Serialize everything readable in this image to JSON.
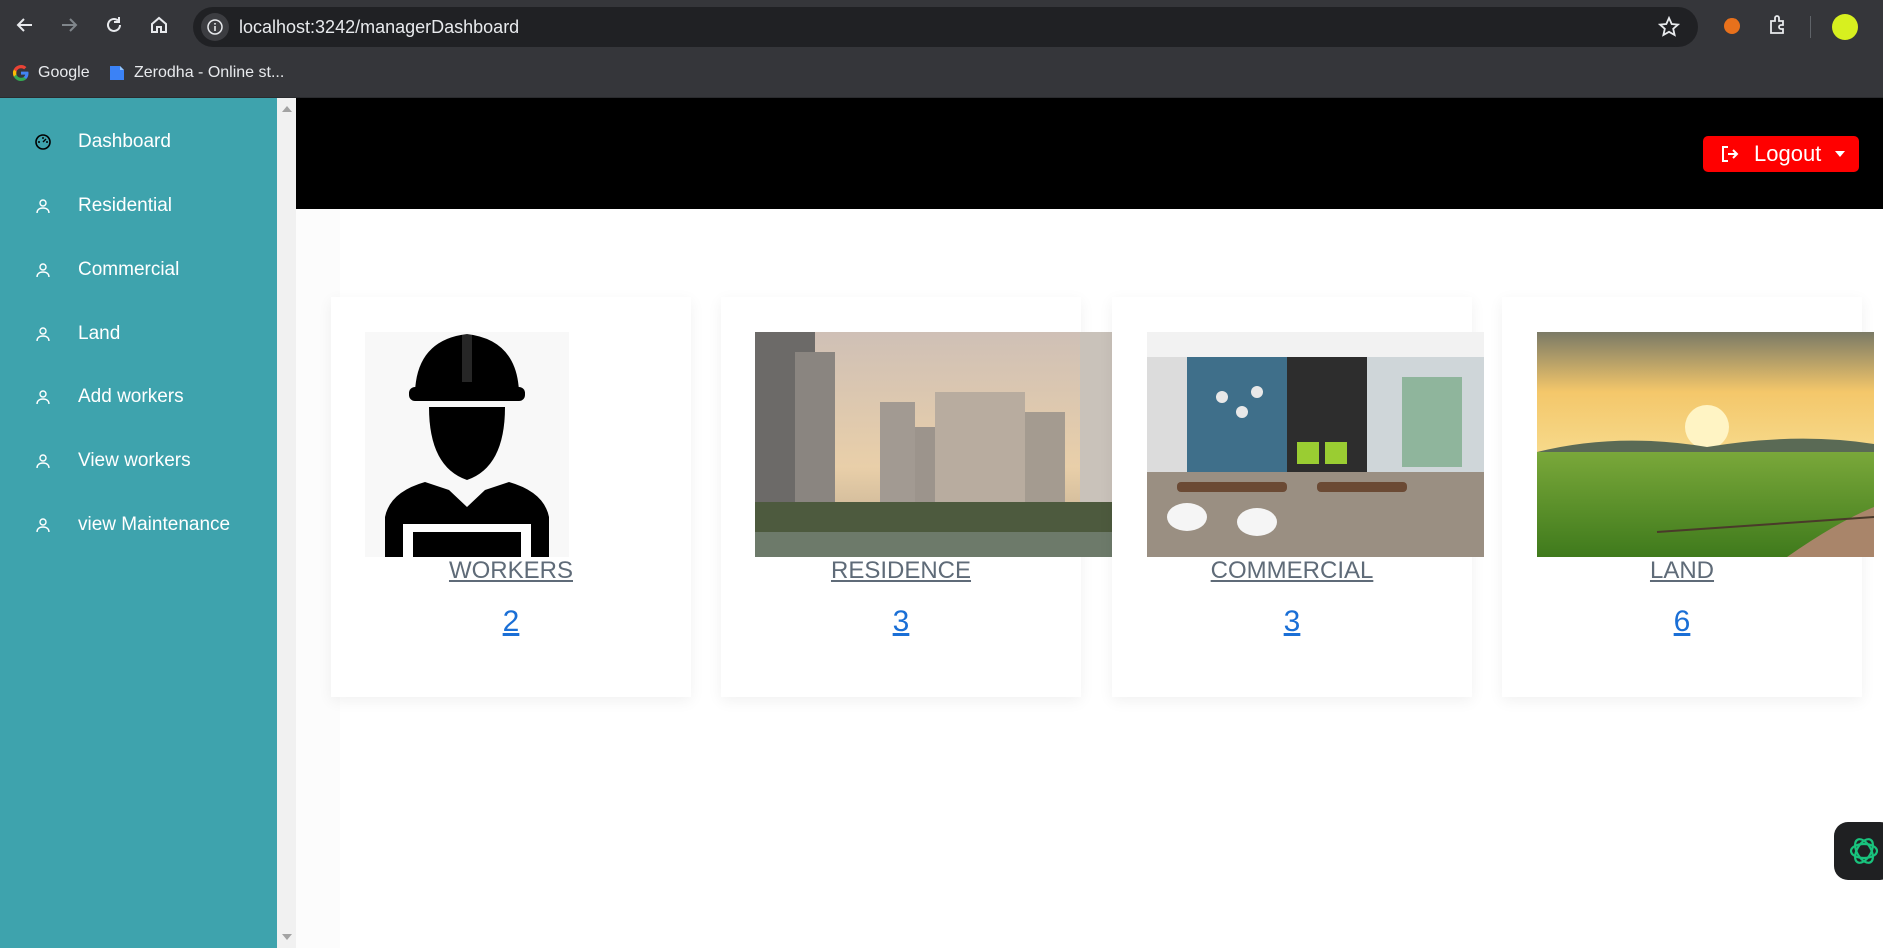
{
  "browser": {
    "url_host": "localhost:3242",
    "url_path": "/managerDashboard",
    "bookmarks": [
      {
        "label": "Google",
        "icon": "google-icon"
      },
      {
        "label": "Zerodha - Online st...",
        "icon": "zerodha-icon"
      }
    ]
  },
  "sidebar": {
    "items": [
      {
        "label": "Dashboard",
        "icon": "dashboard-icon"
      },
      {
        "label": "Residential",
        "icon": "user-icon"
      },
      {
        "label": "Commercial",
        "icon": "user-icon"
      },
      {
        "label": "Land",
        "icon": "user-icon"
      },
      {
        "label": "Add workers",
        "icon": "user-icon"
      },
      {
        "label": "View workers",
        "icon": "user-icon"
      },
      {
        "label": "view Maintenance",
        "icon": "user-icon"
      }
    ],
    "color": "#3ea3ad"
  },
  "header": {
    "logout_label": "Logout",
    "logout_color": "#ff0000"
  },
  "cards": [
    {
      "title": "WORKERS",
      "count": "2",
      "image": "worker-silhouette"
    },
    {
      "title": "RESIDENCE",
      "count": "3",
      "image": "residential-towers"
    },
    {
      "title": "COMMERCIAL",
      "count": "3",
      "image": "commercial-cafe-interior"
    },
    {
      "title": "LAND",
      "count": "6",
      "image": "green-field-sunset"
    }
  ]
}
